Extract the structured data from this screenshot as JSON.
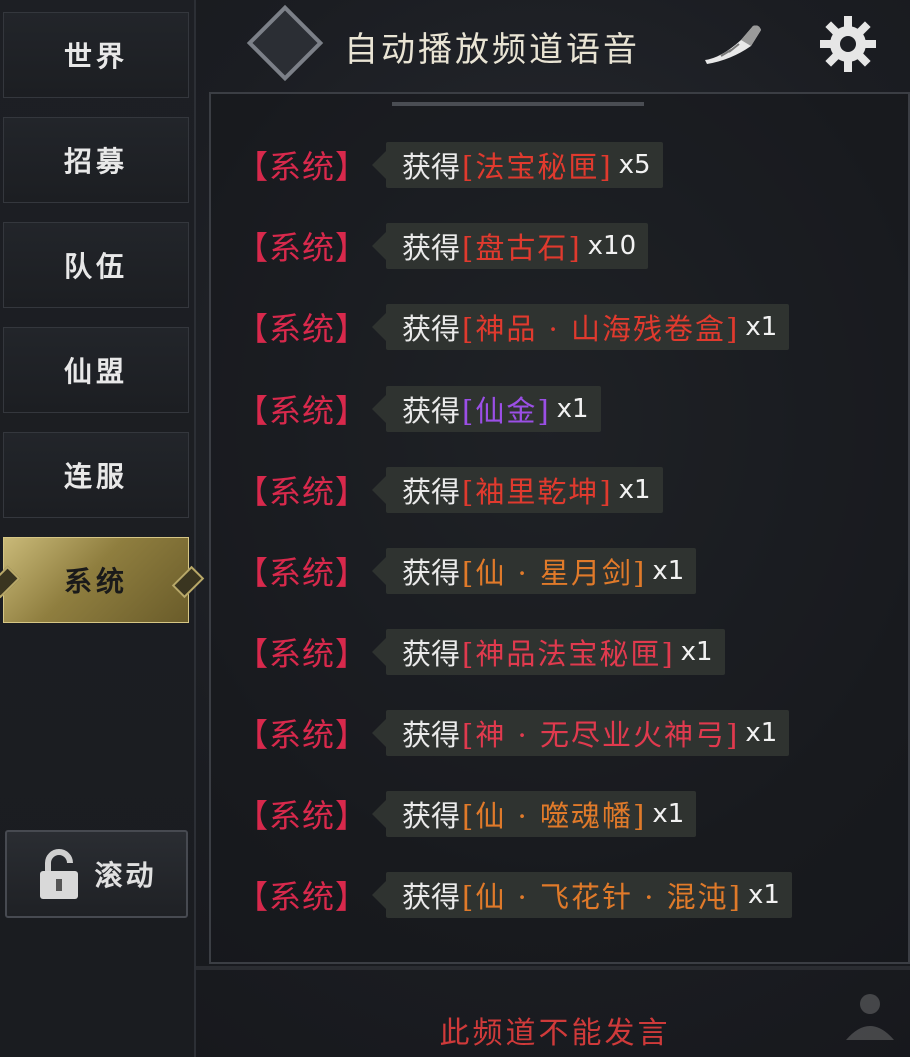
{
  "sidebar": {
    "tabs": [
      {
        "label": "世界"
      },
      {
        "label": "招募"
      },
      {
        "label": "队伍"
      },
      {
        "label": "仙盟"
      },
      {
        "label": "连服"
      },
      {
        "label": "系统"
      }
    ],
    "active_tab": "系统",
    "scroll_label": "滚动"
  },
  "header": {
    "title": "自动播放频道语音",
    "icons": [
      "diamond-icon",
      "horn-icon",
      "gear-icon"
    ]
  },
  "messages": [
    {
      "tag": "【系统】",
      "prefix": "获得",
      "item": "[法宝秘匣]",
      "qty": "x5",
      "color": "#e03a2e"
    },
    {
      "tag": "【系统】",
      "prefix": "获得",
      "item": "[盘古石]",
      "qty": "x10",
      "color": "#e03a2e"
    },
    {
      "tag": "【系统】",
      "prefix": "获得",
      "item": "[神品 · 山海残卷盒]",
      "qty": "x1",
      "color": "#e03a2e"
    },
    {
      "tag": "【系统】",
      "prefix": "获得",
      "item": "[仙金]",
      "qty": "x1",
      "color": "#9b4fe6"
    },
    {
      "tag": "【系统】",
      "prefix": "获得",
      "item": "[袖里乾坤]",
      "qty": "x1",
      "color": "#e03a2e"
    },
    {
      "tag": "【系统】",
      "prefix": "获得",
      "item": "[仙 · 星月剑]",
      "qty": "x1",
      "color": "#e07a2a"
    },
    {
      "tag": "【系统】",
      "prefix": "获得",
      "item": "[神品法宝秘匣]",
      "qty": "x1",
      "color": "#e03a4e"
    },
    {
      "tag": "【系统】",
      "prefix": "获得",
      "item": "[神 · 无尽业火神弓]",
      "qty": "x1",
      "color": "#e03a4e"
    },
    {
      "tag": "【系统】",
      "prefix": "获得",
      "item": "[仙 · 噬魂幡]",
      "qty": "x1",
      "color": "#e07a2a"
    },
    {
      "tag": "【系统】",
      "prefix": "获得",
      "item": "[仙 · 飞花针 · 混沌]",
      "qty": "x1",
      "color": "#e07a2a"
    }
  ],
  "footer": {
    "notice": "此频道不能发言"
  },
  "colors": {
    "system_tag": "#d8294c",
    "active_tab": "#c9b978",
    "notice": "#cf3a3a"
  }
}
